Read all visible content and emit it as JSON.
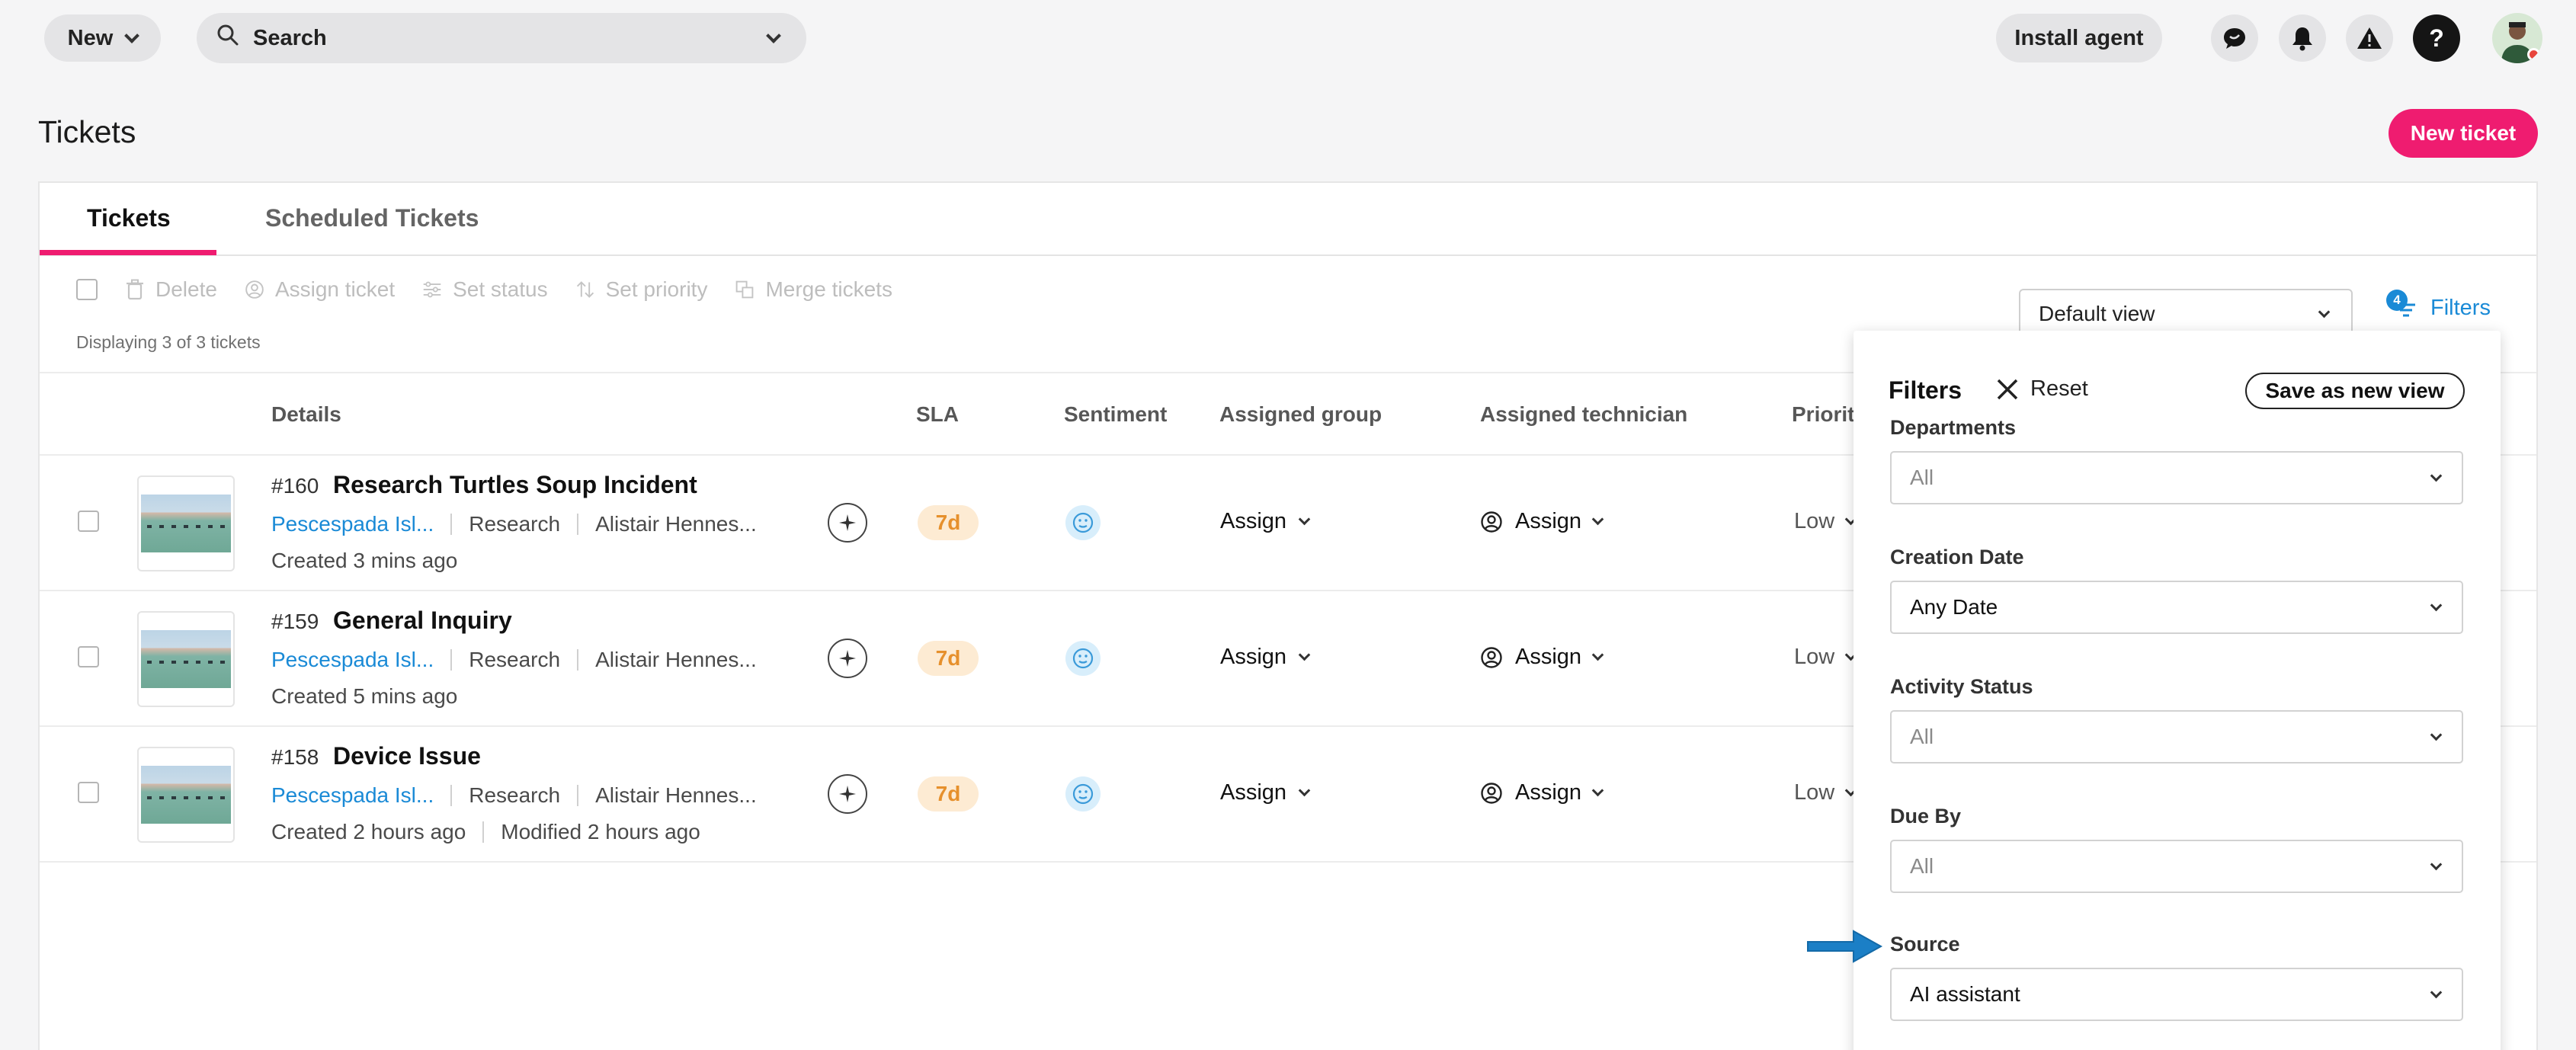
{
  "topbar": {
    "new_label": "New",
    "search_label": "Search",
    "install_label": "Install agent",
    "help_glyph": "?",
    "icons": [
      "chat-icon",
      "bell-icon",
      "warning-icon",
      "help-icon",
      "avatar"
    ]
  },
  "page": {
    "title": "Tickets",
    "new_ticket_label": "New ticket"
  },
  "tabs": [
    {
      "label": "Tickets",
      "active": true
    },
    {
      "label": "Scheduled Tickets",
      "active": false
    }
  ],
  "toolbar": {
    "delete": "Delete",
    "assign_ticket": "Assign ticket",
    "set_status": "Set status",
    "set_priority": "Set priority",
    "merge_tickets": "Merge tickets",
    "displaying": "Displaying 3 of 3 tickets",
    "view": "Default view",
    "filters": "Filters",
    "filter_count": "4"
  },
  "columns": {
    "details": "Details",
    "sla": "SLA",
    "sentiment": "Sentiment",
    "assigned_group": "Assigned group",
    "assigned_technician": "Assigned technician",
    "priority": "Priority"
  },
  "tickets": [
    {
      "id": "#160",
      "title": "Research Turtles Soup Incident",
      "requester": "Pescespada Isl...",
      "department": "Research",
      "person": "Alistair Hennes...",
      "created": "Created 3 mins ago",
      "modified": "",
      "sla": "7d",
      "group": "Assign",
      "technician": "Assign",
      "priority": "Low"
    },
    {
      "id": "#159",
      "title": "General Inquiry",
      "requester": "Pescespada Isl...",
      "department": "Research",
      "person": "Alistair Hennes...",
      "created": "Created 5 mins ago",
      "modified": "",
      "sla": "7d",
      "group": "Assign",
      "technician": "Assign",
      "priority": "Low"
    },
    {
      "id": "#158",
      "title": "Device Issue",
      "requester": "Pescespada Isl...",
      "department": "Research",
      "person": "Alistair Hennes...",
      "created": "Created 2 hours ago",
      "modified": "Modified 2 hours ago",
      "sla": "7d",
      "group": "Assign",
      "technician": "Assign",
      "priority": "Low"
    }
  ],
  "filters_panel": {
    "title": "Filters",
    "reset": "Reset",
    "save_view": "Save as new view",
    "fields": [
      {
        "label": "Departments",
        "value": "All",
        "is_placeholder": true
      },
      {
        "label": "Creation Date",
        "value": "Any Date",
        "is_placeholder": false
      },
      {
        "label": "Activity Status",
        "value": "All",
        "is_placeholder": true
      },
      {
        "label": "Due By",
        "value": "All",
        "is_placeholder": true
      },
      {
        "label": "Source",
        "value": "AI assistant",
        "is_placeholder": false
      }
    ]
  },
  "colors": {
    "accent_pink": "#ef1c70",
    "link_blue": "#1a8ad6",
    "sla_orange": "#e6902c",
    "pointer_blue": "#1b7fc6"
  }
}
